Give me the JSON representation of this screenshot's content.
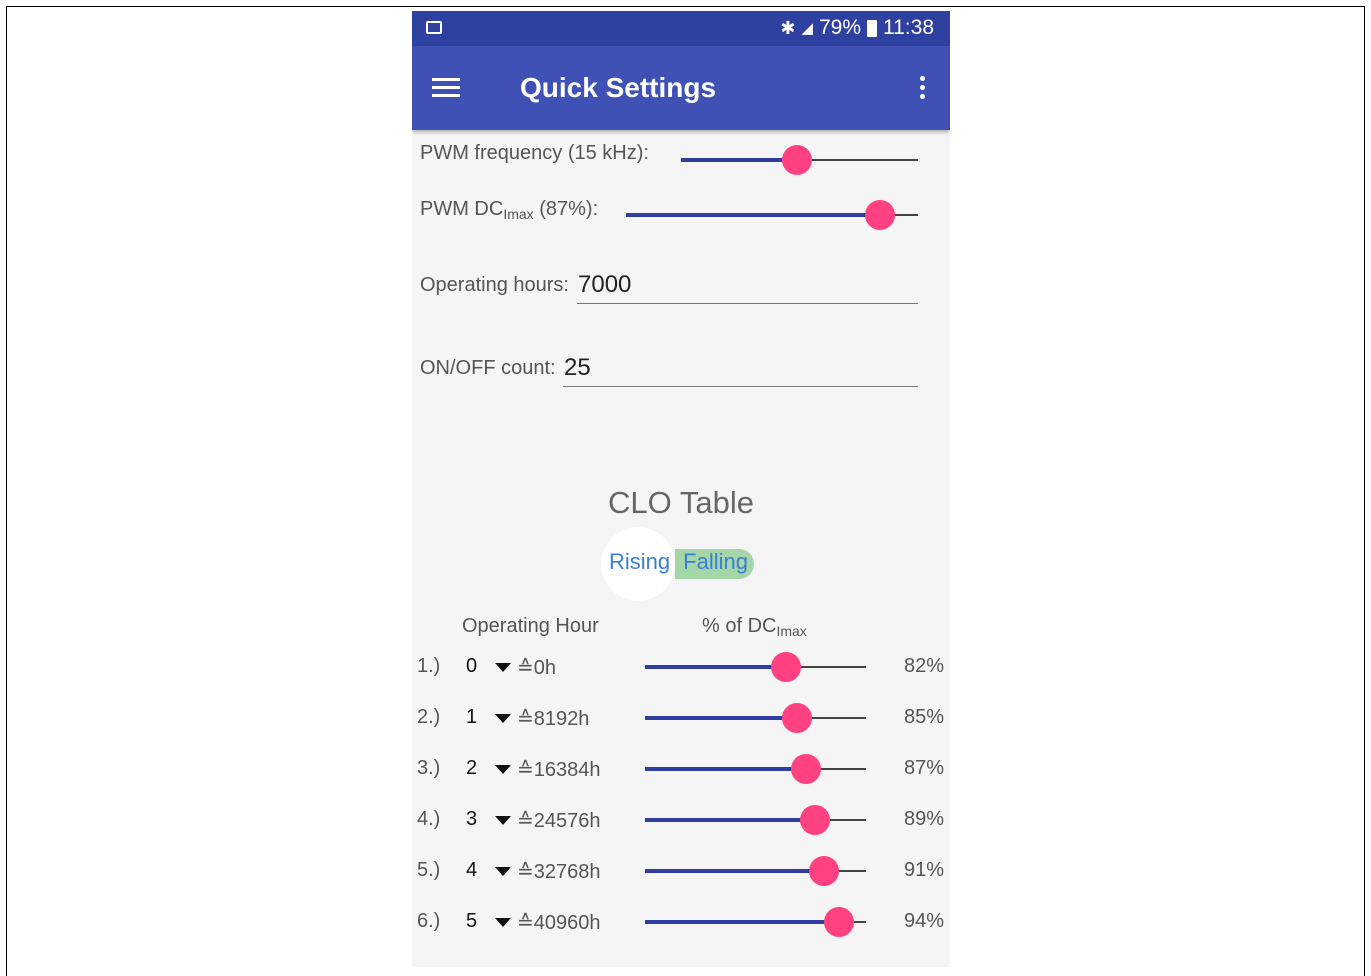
{
  "status": {
    "battery": "79%",
    "time": "11:38"
  },
  "appbar": {
    "title": "Quick Settings"
  },
  "settings": {
    "pwm_freq_label": "PWM frequency (15 kHz):",
    "pwm_freq_level": 0.49,
    "pwm_dc_label_pre": "PWM DC",
    "pwm_dc_label_sub": "Imax",
    "pwm_dc_label_post": " (87%):",
    "pwm_dc_level": 0.87,
    "hours_label": "Operating hours:",
    "hours_value": "7000",
    "count_label": "ON/OFF count:",
    "count_value": "25"
  },
  "clo": {
    "title": "CLO Table",
    "toggle_rising": "Rising",
    "toggle_falling": "Falling",
    "col_hour": "Operating Hour",
    "col_pct_pre": "% of DC",
    "col_pct_sub": "Imax",
    "rows": [
      {
        "num": "1.)",
        "idx": "0",
        "hours": "≙0h",
        "pct": "82%",
        "level": 0.64
      },
      {
        "num": "2.)",
        "idx": "1",
        "hours": "≙8192h",
        "pct": "85%",
        "level": 0.69
      },
      {
        "num": "3.)",
        "idx": "2",
        "hours": "≙16384h",
        "pct": "87%",
        "level": 0.73
      },
      {
        "num": "4.)",
        "idx": "3",
        "hours": "≙24576h",
        "pct": "89%",
        "level": 0.77
      },
      {
        "num": "5.)",
        "idx": "4",
        "hours": "≙32768h",
        "pct": "91%",
        "level": 0.81
      },
      {
        "num": "6.)",
        "idx": "5",
        "hours": "≙40960h",
        "pct": "94%",
        "level": 0.88
      }
    ]
  }
}
